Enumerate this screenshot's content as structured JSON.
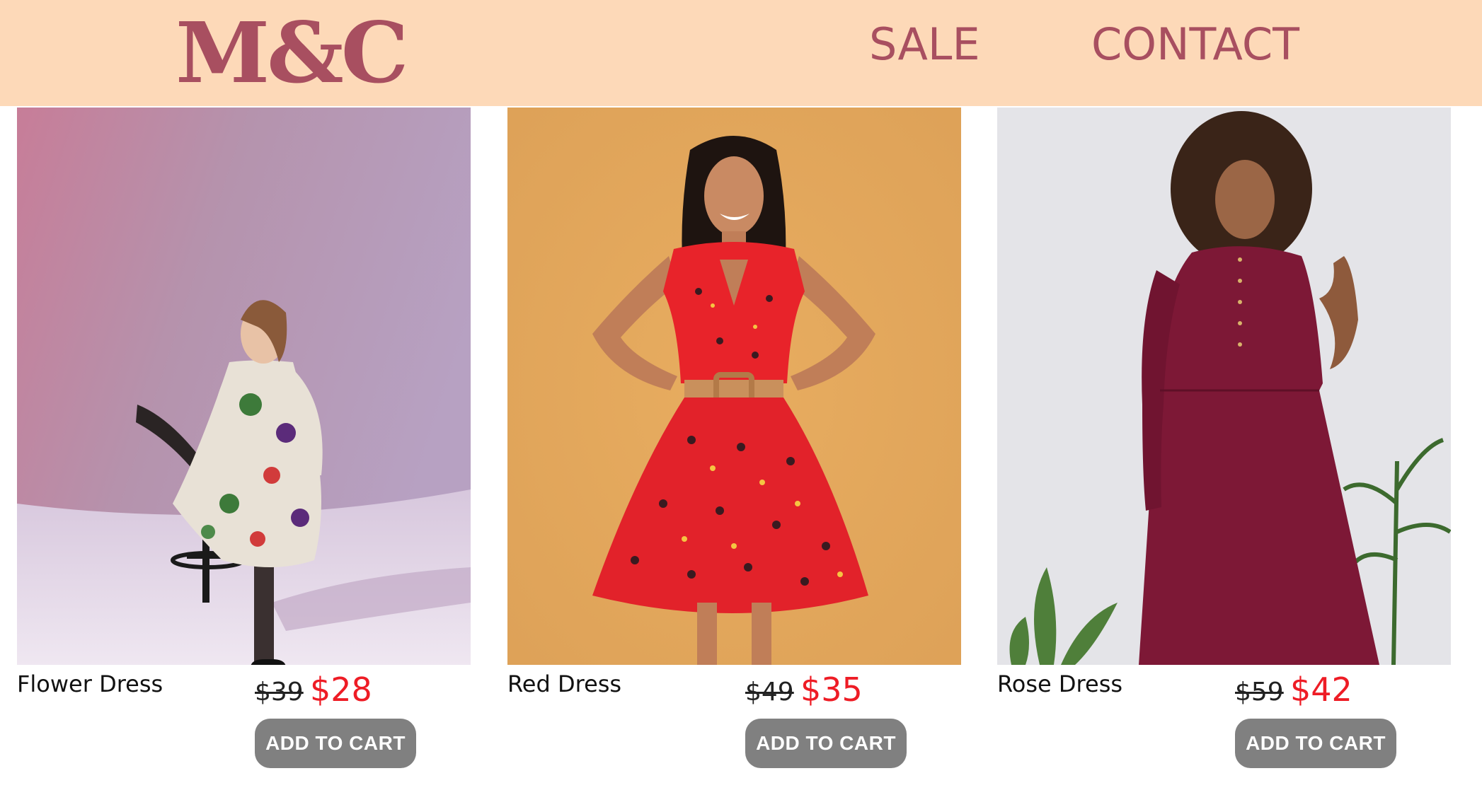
{
  "header": {
    "logo": "M&C",
    "nav": [
      "SALE",
      "CONTACT"
    ]
  },
  "colors": {
    "header_bg": "#fdd9b8",
    "brand": "#a84f60",
    "sale_price": "#ee1c25",
    "button_bg": "#808080"
  },
  "products": [
    {
      "name": "Flower Dress",
      "old_price": "$39",
      "new_price": "$28",
      "button": "ADD TO CART"
    },
    {
      "name": "Red Dress",
      "old_price": "$49",
      "new_price": "$35",
      "button": "ADD TO CART"
    },
    {
      "name": "Rose Dress",
      "old_price": "$59",
      "new_price": "$42",
      "button": "ADD TO CART"
    }
  ]
}
